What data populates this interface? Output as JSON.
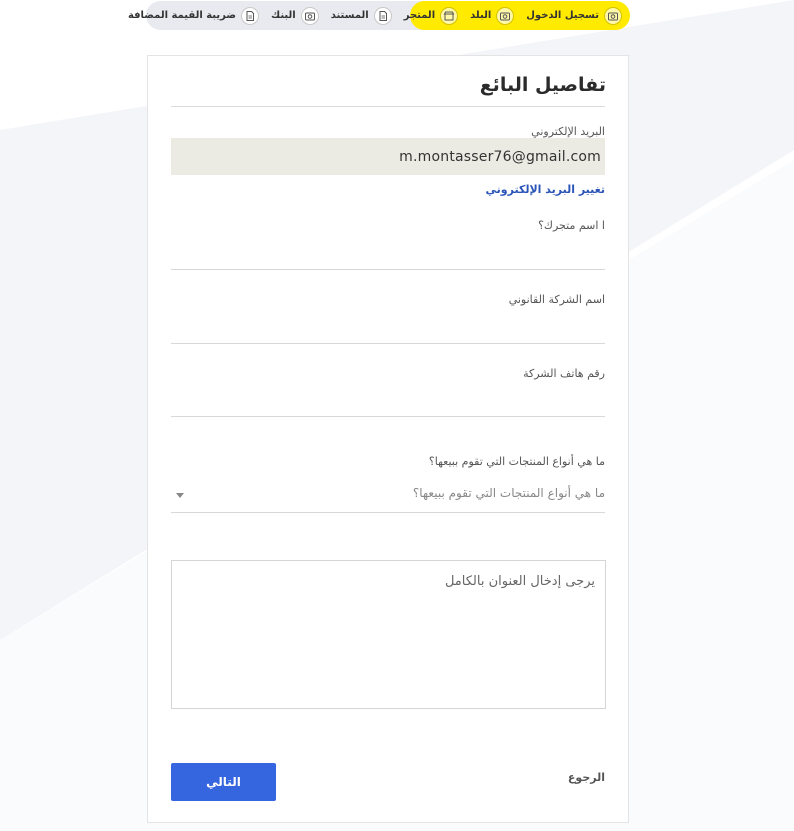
{
  "stepper": {
    "steps": [
      {
        "label": "تسجيل الدخول",
        "icon": "camera-icon",
        "active": true
      },
      {
        "label": "البلد",
        "icon": "camera-icon",
        "active": true
      },
      {
        "label": "المتجر",
        "icon": "store-icon",
        "active": true
      },
      {
        "label": "المستند",
        "icon": "document-icon",
        "active": false
      },
      {
        "label": "البنك",
        "icon": "camera-icon",
        "active": false
      },
      {
        "label": "ضريبة القيمة المضافة",
        "icon": "document-icon",
        "active": false
      }
    ],
    "active_color": "#ffea00"
  },
  "form": {
    "title": "تفاصيل البائع",
    "email": {
      "label": "البريد الإلكتروني",
      "value": "m.montasser76@gmail.com",
      "change_link": "تغيير البريد الإلكتروني"
    },
    "store_name": {
      "label": "ا اسم متجرك؟"
    },
    "legal_name": {
      "label": "اسم الشركة القانوني"
    },
    "phone": {
      "label": "رقم هاتف الشركة"
    },
    "product_types": {
      "label": "ما هي أنواع المنتجات التي تقوم ببيعها؟",
      "placeholder": "ما هي أنواع المنتجات التي تقوم ببيعها؟"
    },
    "address": {
      "placeholder": "يرجى إدخال العنوان بالكامل"
    },
    "next_button": "التالي",
    "back_link": "الرجوع"
  },
  "colors": {
    "primary": "#3566e0",
    "link": "#2a54b8",
    "stepper_active": "#ffea00"
  }
}
